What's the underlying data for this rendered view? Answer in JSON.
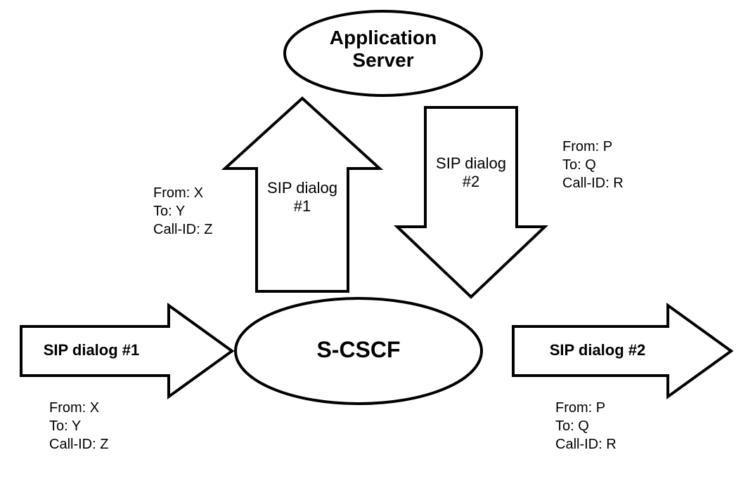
{
  "nodes": {
    "app_server": {
      "line1": "Application",
      "line2": "Server"
    },
    "s_cscf": "S-CSCF"
  },
  "arrows": {
    "in_left": {
      "label": "SIP dialog #1"
    },
    "up": {
      "label_l1": "SIP dialog",
      "label_l2": "#1"
    },
    "down": {
      "label_l1": "SIP dialog",
      "label_l2": "#2"
    },
    "out_right": {
      "label": "SIP dialog #2"
    }
  },
  "headers": {
    "left_up": {
      "from": "From: X",
      "to": "To: Y",
      "callid": "Call-ID: Z"
    },
    "down_right": {
      "from": "From: P",
      "to": "To: Q",
      "callid": "Call-ID: R"
    },
    "in_left_below": {
      "from": "From: X",
      "to": "To: Y",
      "callid": "Call-ID: Z"
    },
    "out_right_below": {
      "from": "From: P",
      "to": "To: Q",
      "callid": "Call-ID: R"
    }
  }
}
